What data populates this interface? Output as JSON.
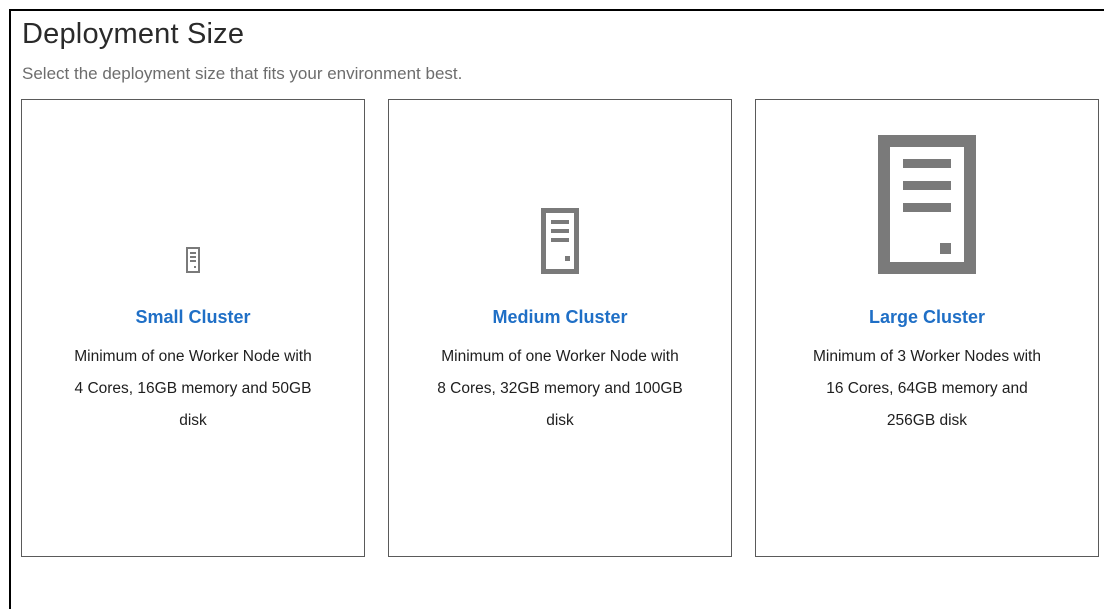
{
  "header": {
    "title": "Deployment Size",
    "subtitle": "Select the deployment size that fits your environment best."
  },
  "colors": {
    "accent": "#1f6fc6",
    "icon": "#7a7a7a",
    "border": "#5a5a5a"
  },
  "cards": [
    {
      "icon": "server-tower-small-icon",
      "title": "Small Cluster",
      "description": "Minimum of one Worker Node with\n4 Cores, 16GB memory and 50GB\ndisk"
    },
    {
      "icon": "server-tower-medium-icon",
      "title": "Medium Cluster",
      "description": "Minimum of one Worker Node with\n8 Cores, 32GB memory and 100GB\ndisk"
    },
    {
      "icon": "server-tower-large-icon",
      "title": "Large Cluster",
      "description": "Minimum of 3 Worker Nodes with\n16 Cores, 64GB memory and\n256GB disk"
    }
  ]
}
